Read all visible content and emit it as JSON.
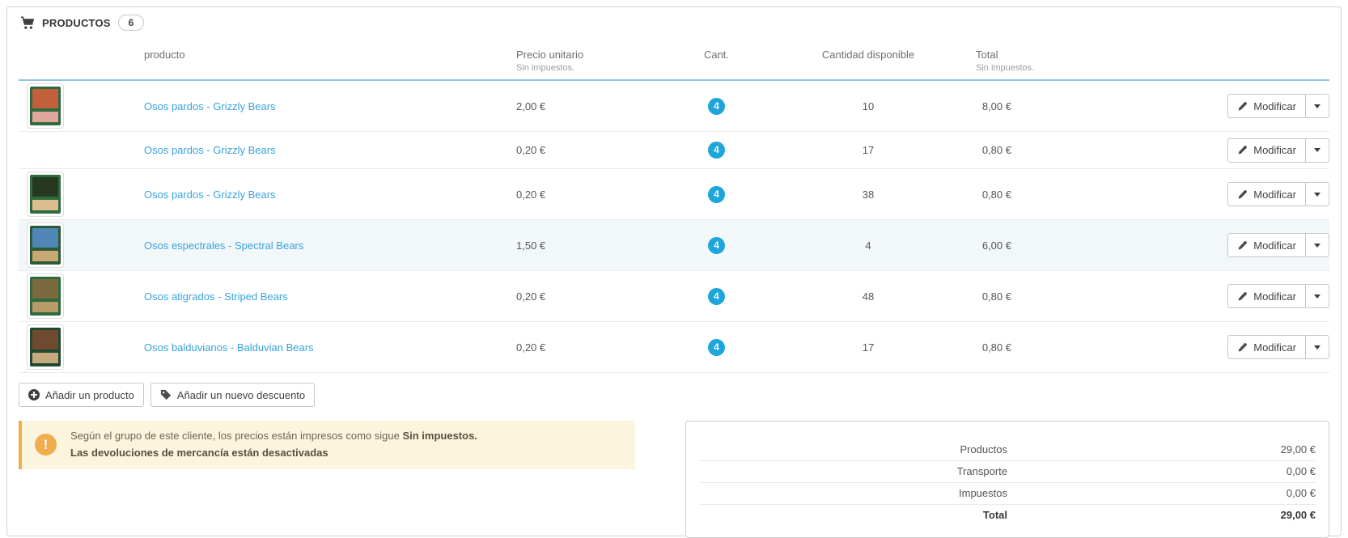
{
  "panel": {
    "title": "PRODUCTOS",
    "badge": "6"
  },
  "table": {
    "headers": {
      "product": "producto",
      "unit_price": "Precio unitario",
      "unit_price_sub": "Sin impuestos.",
      "qty": "Cant.",
      "available": "Cantidad disponible",
      "total": "Total",
      "total_sub": "Sin impuestos."
    },
    "row_action_label": "Modificar",
    "rows": [
      {
        "name": "Osos pardos - Grizzly Bears",
        "unit_price": "2,00 €",
        "qty": "4",
        "available": "10",
        "total": "8,00 €",
        "has_image": true,
        "highlight": false,
        "thumb": {
          "frame": "#2e6b3e",
          "art": "#c35f3b",
          "text": "#e2a79c"
        }
      },
      {
        "name": "Osos pardos - Grizzly Bears",
        "unit_price": "0,20 €",
        "qty": "4",
        "available": "17",
        "total": "0,80 €",
        "has_image": false,
        "highlight": false
      },
      {
        "name": "Osos pardos - Grizzly Bears",
        "unit_price": "0,20 €",
        "qty": "4",
        "available": "38",
        "total": "0,80 €",
        "has_image": true,
        "highlight": false,
        "thumb": {
          "frame": "#2e6b3e",
          "art": "#26381f",
          "text": "#dcbd8e"
        }
      },
      {
        "name": "Osos espectrales - Spectral Bears",
        "unit_price": "1,50 €",
        "qty": "4",
        "available": "4",
        "total": "6,00 €",
        "has_image": true,
        "highlight": true,
        "thumb": {
          "frame": "#2d5a36",
          "art": "#4f86b5",
          "text": "#c8a873"
        }
      },
      {
        "name": "Osos atigrados - Striped Bears",
        "unit_price": "0,20 €",
        "qty": "4",
        "available": "48",
        "total": "0,80 €",
        "has_image": true,
        "highlight": false,
        "thumb": {
          "frame": "#2e6b3e",
          "art": "#7a6a3d",
          "text": "#b89a67"
        }
      },
      {
        "name": "Osos balduvianos - Balduvian Bears",
        "unit_price": "0,20 €",
        "qty": "4",
        "available": "17",
        "total": "0,80 €",
        "has_image": true,
        "highlight": false,
        "thumb": {
          "frame": "#1f4a2f",
          "art": "#6e4a2f",
          "text": "#c7a97e"
        }
      }
    ]
  },
  "actions": {
    "add_product": "Añadir un producto",
    "add_discount": "Añadir un nuevo descuento"
  },
  "warning": {
    "line1_normal": "Según el grupo de este cliente, los precios están impresos como sigue ",
    "line1_bold": "Sin impuestos.",
    "line2": "Las devoluciones de mercancía están desactivadas"
  },
  "totals": {
    "rows": [
      {
        "label": "Productos",
        "value": "29,00 €",
        "bold": false
      },
      {
        "label": "Transporte",
        "value": "0,00 €",
        "bold": false
      },
      {
        "label": "Impuestos",
        "value": "0,00 €",
        "bold": false
      },
      {
        "label": "Total",
        "value": "29,00 €",
        "bold": true
      }
    ]
  },
  "colors": {
    "link": "#38a3dc",
    "badge": "#1ea6dc",
    "warning_accent": "#f0ad4e",
    "header_rule": "#92c4e2"
  }
}
